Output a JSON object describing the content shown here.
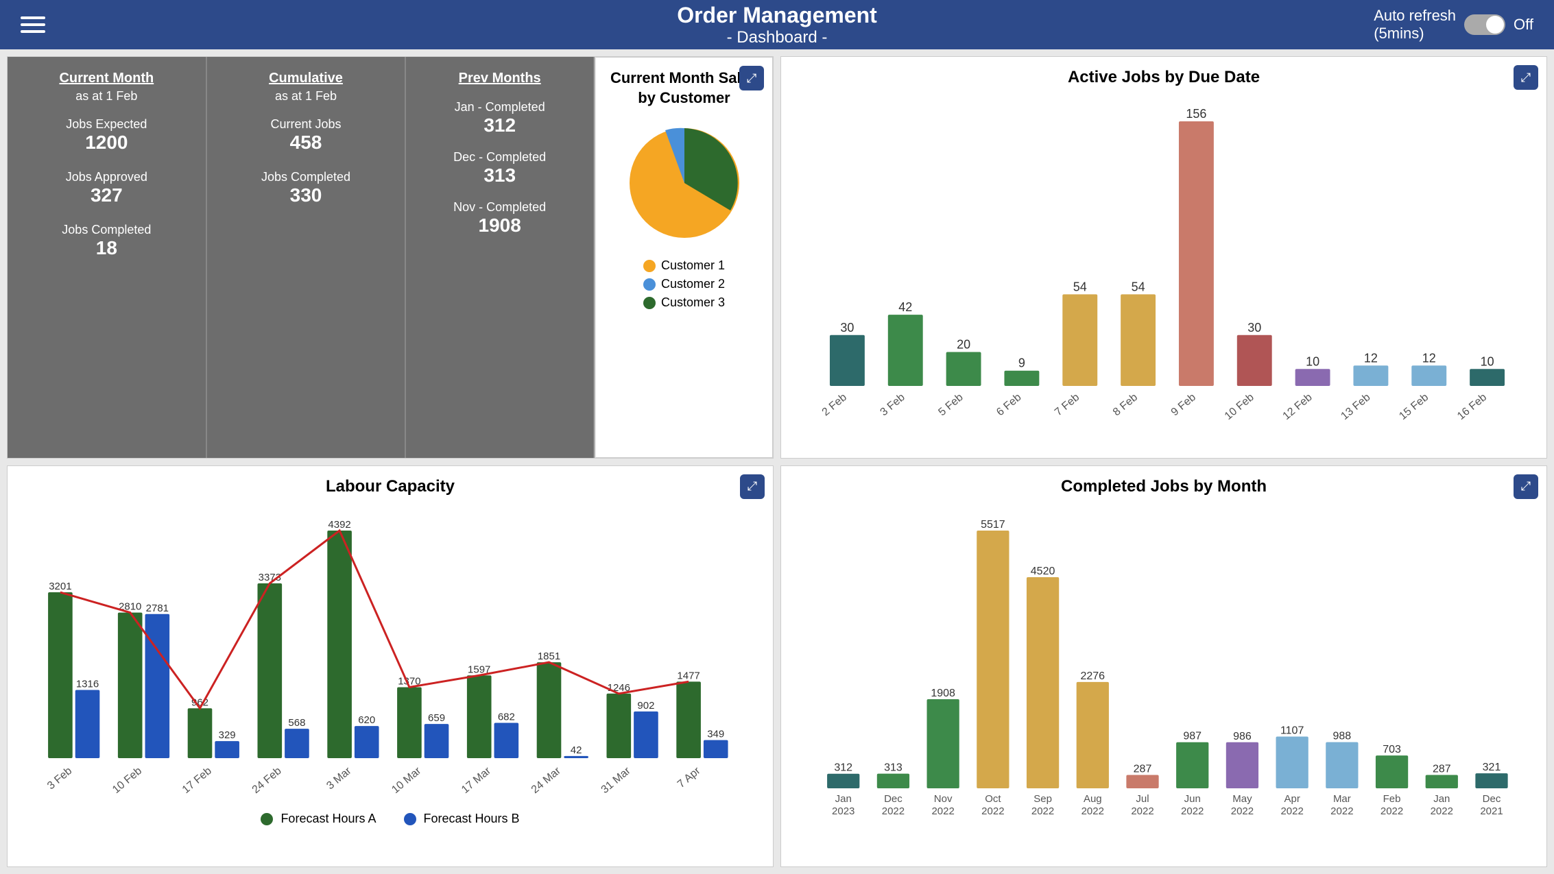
{
  "header": {
    "menu_label": "Menu",
    "title_main": "Order Management",
    "title_sub": "- Dashboard -",
    "auto_refresh_label": "Auto refresh",
    "auto_refresh_interval": "(5mins)",
    "auto_refresh_state": "Off"
  },
  "current_month": {
    "title": "Current Month",
    "subtitle": "as at 1 Feb",
    "stats": [
      {
        "label": "Jobs Expected",
        "value": "1200"
      },
      {
        "label": "Jobs Approved",
        "value": "327"
      },
      {
        "label": "Jobs Completed",
        "value": "18"
      }
    ]
  },
  "cumulative": {
    "title": "Cumulative",
    "subtitle": "as at 1 Feb",
    "stats": [
      {
        "label": "Current Jobs",
        "value": "458"
      },
      {
        "label": "Jobs Completed",
        "value": "330"
      }
    ]
  },
  "prev_months": {
    "title": "Prev Months",
    "items": [
      {
        "label": "Jan - Completed",
        "value": "312"
      },
      {
        "label": "Dec - Completed",
        "value": "313"
      },
      {
        "label": "Nov - Completed",
        "value": "1908"
      }
    ]
  },
  "pie_chart": {
    "title": "Current Month Sales by Customer",
    "expand_icon": "⤢",
    "legend": [
      {
        "label": "Customer 1",
        "color": "#f5a623"
      },
      {
        "label": "Customer 2",
        "color": "#4a90d9"
      },
      {
        "label": "Customer 3",
        "color": "#2d6a2d"
      }
    ]
  },
  "active_jobs_chart": {
    "title": "Active Jobs by Due Date",
    "expand_icon": "⤢",
    "bars": [
      {
        "date": "2 Feb",
        "value": 30,
        "color": "#2d6a6a"
      },
      {
        "date": "3 Feb",
        "value": 42,
        "color": "#3d8a4a"
      },
      {
        "date": "5 Feb",
        "value": 20,
        "color": "#3d8a4a"
      },
      {
        "date": "6 Feb",
        "value": 9,
        "color": "#3d8a4a"
      },
      {
        "date": "7 Feb",
        "value": 54,
        "color": "#d4a84b"
      },
      {
        "date": "8 Feb",
        "value": 54,
        "color": "#d4a84b"
      },
      {
        "date": "9 Feb",
        "value": 156,
        "color": "#c97a6a"
      },
      {
        "date": "10 Feb",
        "value": 30,
        "color": "#b05555"
      },
      {
        "date": "12 Feb",
        "value": 10,
        "color": "#8a6ab0"
      },
      {
        "date": "13 Feb",
        "value": 12,
        "color": "#7ab0d4"
      },
      {
        "date": "15 Feb",
        "value": 12,
        "color": "#7ab0d4"
      },
      {
        "date": "16 Feb",
        "value": 10,
        "color": "#2d6a6a"
      }
    ]
  },
  "labour_capacity_chart": {
    "title": "Labour Capacity",
    "expand_icon": "⤢",
    "bars_a": [
      {
        "week": "3 Feb",
        "value": 3201
      },
      {
        "week": "10 Feb",
        "value": 2810
      },
      {
        "week": "17 Feb",
        "value": 962
      },
      {
        "week": "24 Feb",
        "value": 3373
      },
      {
        "week": "3 Mar",
        "value": 4392
      },
      {
        "week": "10 Mar",
        "value": 1370
      },
      {
        "week": "17 Mar",
        "value": 1597
      },
      {
        "week": "24 Mar",
        "value": 1851
      },
      {
        "week": "31 Mar",
        "value": 1246
      },
      {
        "week": "7 Apr",
        "value": 1477
      }
    ],
    "bars_b": [
      {
        "week": "3 Feb",
        "value": 1316
      },
      {
        "week": "10 Feb",
        "value": 2781
      },
      {
        "week": "17 Feb",
        "value": 329
      },
      {
        "week": "24 Feb",
        "value": 568
      },
      {
        "week": "3 Mar",
        "value": 620
      },
      {
        "week": "10 Mar",
        "value": 659
      },
      {
        "week": "17 Mar",
        "value": 682
      },
      {
        "week": "24 Mar",
        "value": 42
      },
      {
        "week": "31 Mar",
        "value": 902
      },
      {
        "week": "7 Apr",
        "value": 349
      }
    ],
    "legend": [
      {
        "label": "Forecast Hours A",
        "color": "#2d6a2d"
      },
      {
        "label": "Forecast Hours B",
        "color": "#2255bb"
      }
    ]
  },
  "completed_jobs_chart": {
    "title": "Completed Jobs by Month",
    "expand_icon": "⤢",
    "bars": [
      {
        "month": "Jan\n2023",
        "value": 312,
        "color": "#2d6a6a"
      },
      {
        "month": "Dec\n2022",
        "value": 313,
        "color": "#3d8a4a"
      },
      {
        "month": "Nov\n2022",
        "value": 1908,
        "color": "#3d8a4a"
      },
      {
        "month": "Oct\n2022",
        "value": 5517,
        "color": "#d4a84b"
      },
      {
        "month": "Sep\n2022",
        "value": 4520,
        "color": "#d4a84b"
      },
      {
        "month": "Aug\n2022",
        "value": 2276,
        "color": "#d4a84b"
      },
      {
        "month": "Jul\n2022",
        "value": 287,
        "color": "#c97a6a"
      },
      {
        "month": "Jun\n2022",
        "value": 987,
        "color": "#3d8a4a"
      },
      {
        "month": "May\n2022",
        "value": 986,
        "color": "#8a6ab0"
      },
      {
        "month": "Apr\n2022",
        "value": 1107,
        "color": "#7ab0d4"
      },
      {
        "month": "Mar\n2022",
        "value": 988,
        "color": "#7ab0d4"
      },
      {
        "month": "Feb\n2022",
        "value": 703,
        "color": "#3d8a4a"
      },
      {
        "month": "Jan\n2022",
        "value": 287,
        "color": "#3d8a4a"
      },
      {
        "month": "Dec\n2021",
        "value": 321,
        "color": "#2d6a6a"
      }
    ]
  }
}
